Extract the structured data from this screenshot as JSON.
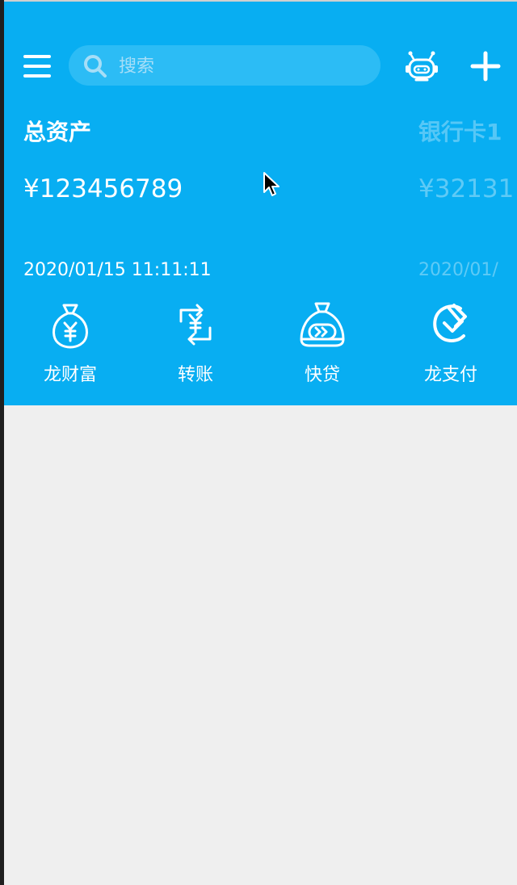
{
  "search": {
    "placeholder": "搜索"
  },
  "cards": [
    {
      "title": "总资产",
      "amount": "¥123456789",
      "time": "2020/01/15 11:11:11"
    },
    {
      "title": "银行卡1",
      "amount": "¥32131",
      "time": "2020/01/"
    }
  ],
  "shortcuts": [
    {
      "label": "龙财富",
      "icon": "money-bag-yuan-icon"
    },
    {
      "label": "转账",
      "icon": "transfer-yuan-icon"
    },
    {
      "label": "快贷",
      "icon": "quick-loan-bag-icon"
    },
    {
      "label": "龙支付",
      "icon": "dragon-pay-icon"
    }
  ],
  "colors": {
    "header": "#08aef2",
    "page_bg": "#efefef",
    "search_bg": "#2cbcf5"
  }
}
